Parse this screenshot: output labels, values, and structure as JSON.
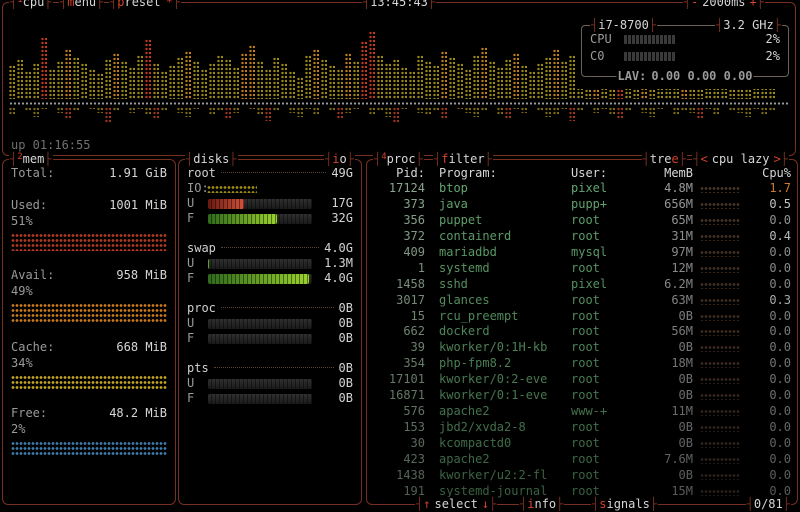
{
  "colors": {
    "border": "#77301f",
    "accent": "#d3422a",
    "graph_low": "#9c8a16",
    "graph_mid": "#c07d1d",
    "graph_high": "#c0391f",
    "graph_lower_low": "#7a6812",
    "graph_lower_high": "#99341f",
    "mem_used": "#b03a24",
    "mem_avail": "#c97a20",
    "mem_cache": "#c3a424",
    "mem_free": "#3f7cae"
  },
  "cpu_box": {
    "tab_num": "1",
    "tab_label": "cpu",
    "menu_label": "menu",
    "preset_label": "preset",
    "preset_star": "*",
    "clock": "13:45:43",
    "interval_minus": "-",
    "interval_value": "2000ms",
    "interval_plus": "+",
    "model": "i7-8700",
    "freq": "3.2 GHz",
    "meters": [
      {
        "label": "CPU",
        "pct": "2%"
      },
      {
        "label": "C0",
        "pct": "2%"
      }
    ],
    "lav_label": "LAV:",
    "lav_values": "0.00 0.00 0.00",
    "uptime": "up 01:16:55",
    "graph": {
      "type": "area",
      "upper": [
        34,
        40,
        28,
        36,
        62,
        30,
        38,
        50,
        42,
        36,
        30,
        26,
        40,
        46,
        38,
        32,
        44,
        60,
        36,
        28,
        34,
        42,
        48,
        38,
        30,
        36,
        44,
        40,
        32,
        46,
        54,
        38,
        30,
        42,
        36,
        28,
        22,
        44,
        50,
        40,
        34,
        30,
        46,
        38,
        58,
        68,
        44,
        36,
        40,
        32,
        28,
        44,
        38,
        34,
        48,
        42,
        36,
        30,
        44,
        52,
        38,
        32,
        40,
        46,
        34,
        28,
        36,
        42,
        50,
        38,
        44,
        32,
        38,
        46,
        40,
        34,
        62,
        44,
        38,
        52,
        42,
        36,
        32,
        40,
        46,
        38,
        30,
        36,
        44,
        40,
        34,
        38,
        42,
        36,
        40,
        44
      ],
      "lower": [
        8,
        0,
        4,
        10,
        2,
        0,
        6,
        12,
        4,
        0,
        2,
        6,
        16,
        4,
        0,
        6,
        2,
        8,
        12,
        4,
        0,
        6,
        10,
        2,
        0,
        8,
        4,
        12,
        6,
        0,
        2,
        8,
        14,
        4,
        0,
        6,
        10,
        2,
        8,
        0,
        4,
        12,
        6,
        2,
        0,
        8,
        4,
        10,
        16,
        2,
        0,
        6,
        8,
        4,
        12,
        0,
        2,
        6,
        10,
        4,
        0,
        8,
        12,
        2,
        6,
        0,
        4,
        10,
        8,
        2,
        14,
        4,
        0,
        6,
        2,
        8,
        12,
        4,
        0,
        6,
        10,
        2,
        0,
        8,
        4,
        6,
        12,
        2,
        8,
        0,
        4,
        6,
        10,
        2,
        8,
        4
      ]
    }
  },
  "mem_box": {
    "tab_num": "2",
    "tab_label": "mem",
    "total_label": "Total:",
    "total_value": "1.91 GiB",
    "rows": [
      {
        "label": "Used:",
        "value": "1001 MiB",
        "pct": "51%",
        "color": "#b03a24"
      },
      {
        "label": "Avail:",
        "value": "958 MiB",
        "pct": "49%",
        "color": "#c97a20"
      },
      {
        "label": "Cache:",
        "value": "668 MiB",
        "pct": "34%",
        "color": "#c3a424"
      },
      {
        "label": "Free:",
        "value": "48.2 MiB",
        "pct": "2%",
        "color": "#3f7cae"
      }
    ]
  },
  "disks_box": {
    "tab_label": "disks",
    "io_tab_label": "io",
    "used_label": "U",
    "free_label": "F",
    "disks": [
      {
        "name": "root",
        "size": "49G",
        "io_row_label": "IO:",
        "used": "17G",
        "used_pct": 35,
        "used_kind": "red",
        "free": "32G",
        "free_pct": 66,
        "free_kind": "green"
      },
      {
        "name": "swap",
        "size": "4.0G",
        "used": "1.3M",
        "used_pct": 1,
        "used_kind": "green",
        "free": "4.0G",
        "free_pct": 97,
        "free_kind": "green"
      },
      {
        "name": "proc",
        "size": "0B",
        "used": "0B",
        "used_pct": 0,
        "used_kind": "green",
        "free": "0B",
        "free_pct": 0,
        "free_kind": "green"
      },
      {
        "name": "pts",
        "size": "0B",
        "used": "0B",
        "used_pct": 0,
        "used_kind": "green",
        "free": "0B",
        "free_pct": 0,
        "free_kind": "green"
      }
    ]
  },
  "proc_box": {
    "tab_num": "4",
    "tab_label": "proc",
    "filter_label": "filter",
    "tree_pre": "tre",
    "tree_key": "e",
    "sort_left": "<",
    "sort_label": "cpu lazy",
    "sort_right": ">",
    "columns": {
      "pid": "Pid:",
      "program": "Program:",
      "user": "User:",
      "mem": "MemB",
      "cpu": "Cpu%"
    },
    "rows": [
      {
        "pid": "17124",
        "program": "btop",
        "user": "pixel",
        "mem": "4.8M",
        "cpu": "1.7"
      },
      {
        "pid": "373",
        "program": "java",
        "user": "pupp+",
        "mem": "656M",
        "cpu": "0.5"
      },
      {
        "pid": "356",
        "program": "puppet",
        "user": "root",
        "mem": "65M",
        "cpu": "0.0"
      },
      {
        "pid": "372",
        "program": "containerd",
        "user": "root",
        "mem": "31M",
        "cpu": "0.4"
      },
      {
        "pid": "409",
        "program": "mariadbd",
        "user": "mysql",
        "mem": "97M",
        "cpu": "0.0"
      },
      {
        "pid": "1",
        "program": "systemd",
        "user": "root",
        "mem": "12M",
        "cpu": "0.0"
      },
      {
        "pid": "1458",
        "program": "sshd",
        "user": "pixel",
        "mem": "6.2M",
        "cpu": "0.0"
      },
      {
        "pid": "3017",
        "program": "glances",
        "user": "root",
        "mem": "63M",
        "cpu": "0.3"
      },
      {
        "pid": "15",
        "program": "rcu_preempt",
        "user": "root",
        "mem": "0B",
        "cpu": "0.0"
      },
      {
        "pid": "662",
        "program": "dockerd",
        "user": "root",
        "mem": "56M",
        "cpu": "0.0"
      },
      {
        "pid": "39",
        "program": "kworker/0:1H-kb",
        "user": "root",
        "mem": "0B",
        "cpu": "0.0"
      },
      {
        "pid": "354",
        "program": "php-fpm8.2",
        "user": "root",
        "mem": "18M",
        "cpu": "0.0"
      },
      {
        "pid": "17101",
        "program": "kworker/0:2-eve",
        "user": "root",
        "mem": "0B",
        "cpu": "0.0"
      },
      {
        "pid": "16871",
        "program": "kworker/0:1-eve",
        "user": "root",
        "mem": "0B",
        "cpu": "0.0"
      },
      {
        "pid": "576",
        "program": "apache2",
        "user": "www-+",
        "mem": "11M",
        "cpu": "0.0"
      },
      {
        "pid": "153",
        "program": "jbd2/xvda2-8",
        "user": "root",
        "mem": "0B",
        "cpu": "0.0"
      },
      {
        "pid": "30",
        "program": "kcompactd0",
        "user": "root",
        "mem": "0B",
        "cpu": "0.0"
      },
      {
        "pid": "423",
        "program": "apache2",
        "user": "root",
        "mem": "7.6M",
        "cpu": "0.0"
      },
      {
        "pid": "1438",
        "program": "kworker/u2:2-fl",
        "user": "root",
        "mem": "0B",
        "cpu": "0.0"
      },
      {
        "pid": "191",
        "program": "systemd-journal",
        "user": "root",
        "mem": "15M",
        "cpu": "0.0"
      }
    ],
    "footer": {
      "select_up": "↑",
      "select": "select",
      "select_down": "↓",
      "info": "info",
      "signals": "signals",
      "count": "0/81"
    }
  }
}
